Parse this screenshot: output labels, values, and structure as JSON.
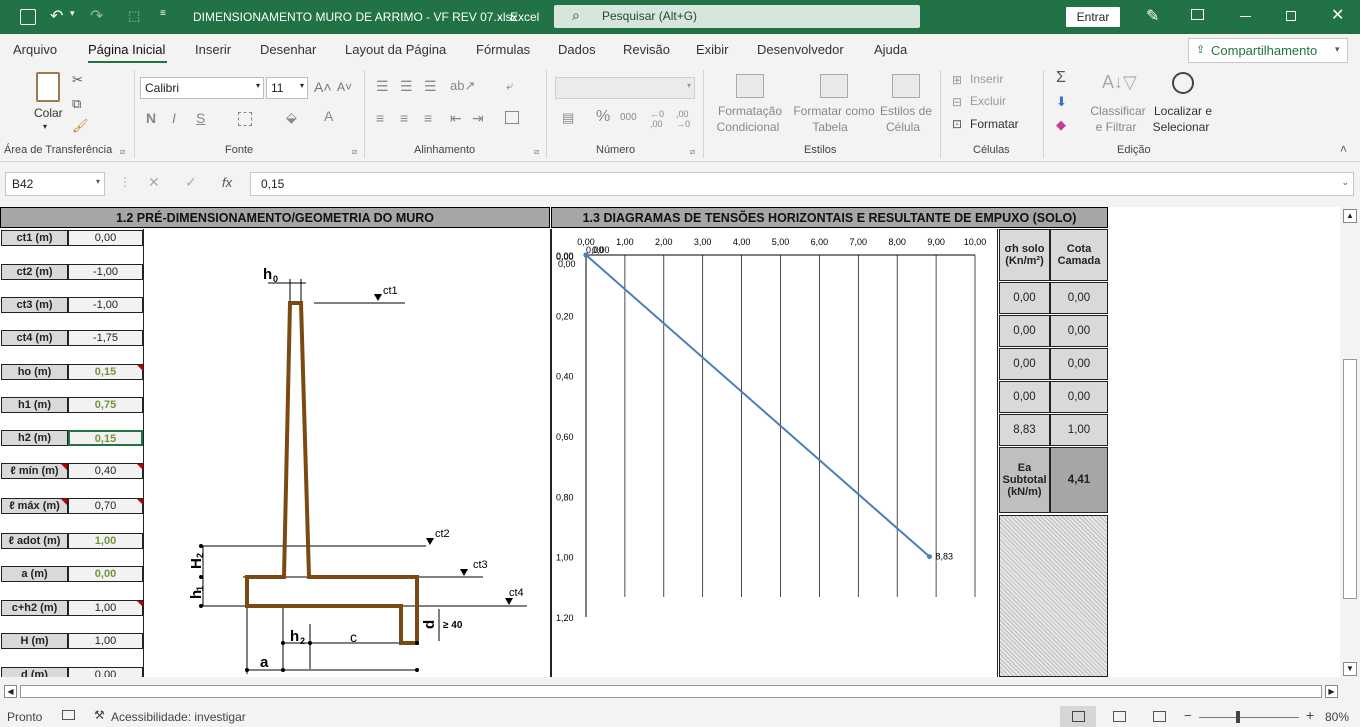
{
  "titlebar": {
    "filename": "DIMENSIONAMENTO MURO DE ARRIMO - VF REV 07.xlsx",
    "app": "Excel",
    "search": "Pesquisar (Alt+G)",
    "signin": "Entrar"
  },
  "menu": {
    "tabs": [
      "Arquivo",
      "Página Inicial",
      "Inserir",
      "Desenhar",
      "Layout da Página",
      "Fórmulas",
      "Dados",
      "Revisão",
      "Exibir",
      "Desenvolvedor",
      "Ajuda"
    ],
    "active": "Página Inicial",
    "share": "Compartilhamento"
  },
  "ribbon": {
    "paste": "Colar",
    "clipboard": "Área de Transferência",
    "font_name": "Calibri",
    "font_size": "11",
    "bold": "N",
    "italic": "I",
    "underline": "S",
    "font_group": "Fonte",
    "align_group": "Alinhamento",
    "number_group": "Número",
    "cond_format": [
      "Formatação",
      "Condicional"
    ],
    "format_table": [
      "Formatar como",
      "Tabela"
    ],
    "cell_styles": [
      "Estilos de",
      "Célula"
    ],
    "styles_group": "Estilos",
    "insert": "Inserir",
    "delete": "Excluir",
    "format": "Formatar",
    "cells_group": "Células",
    "sort": [
      "Classificar",
      "e Filtrar"
    ],
    "find": [
      "Localizar e",
      "Selecionar"
    ],
    "edit_group": "Edição"
  },
  "formula_bar": {
    "cell": "B42",
    "fx": "fx",
    "value": "0,15"
  },
  "sheet": {
    "header_left": "1.2 PRÉ-DIMENSIONAMENTO/GEOMETRIA DO MURO",
    "header_right": "1.3 DIAGRAMAS DE TENSÕES HORIZONTAIS E RESULTANTE DE EMPUXO (SOLO)",
    "params": [
      {
        "label": "ct1 (m)",
        "value": "0,00",
        "green": false
      },
      {
        "label": "ct2 (m)",
        "value": "-1,00",
        "green": false
      },
      {
        "label": "ct3 (m)",
        "value": "-1,00",
        "green": false
      },
      {
        "label": "ct4 (m)",
        "value": "-1,75",
        "green": false
      },
      {
        "label": "ho (m)",
        "value": "0,15",
        "green": true
      },
      {
        "label": "h1 (m)",
        "value": "0,75",
        "green": true
      },
      {
        "label": "h2 (m)",
        "value": "0,15",
        "green": true
      },
      {
        "label": "ℓ mín (m)",
        "value": "0,40",
        "green": false
      },
      {
        "label": "ℓ máx (m)",
        "value": "0,70",
        "green": false
      },
      {
        "label": "ℓ adot (m)",
        "value": "1,00",
        "green": true
      },
      {
        "label": "a (m)",
        "value": "0,00",
        "green": true
      },
      {
        "label": "c+h2 (m)",
        "value": "1,00",
        "green": false
      },
      {
        "label": "H (m)",
        "value": "1,00",
        "green": false
      },
      {
        "label": "d (m)",
        "value": "0,00",
        "green": false
      }
    ],
    "drawing_labels": {
      "h0": "h",
      "h0sub": "0",
      "ct1": "ct1",
      "ct2": "ct2",
      "ct3": "ct3",
      "ct4": "ct4",
      "H2": "H",
      "H2sub": "2",
      "h1": "h",
      "h1sub": "1",
      "h2": "h",
      "h2sub": "2",
      "c": "c",
      "a": "a",
      "d": "d",
      "geq40": "≥ 40"
    },
    "table": {
      "head1": "σh solo (Kn/m²)",
      "head2": "Cota Camada",
      "rows": [
        [
          "0,00",
          "0,00"
        ],
        [
          "0,00",
          "0,00"
        ],
        [
          "0,00",
          "0,00"
        ],
        [
          "0,00",
          "0,00"
        ],
        [
          "8,83",
          "1,00"
        ]
      ],
      "ea_label": "Ea Subtotal (kN/m)",
      "ea_value": "4,41"
    }
  },
  "chart_data": {
    "type": "line",
    "title": "",
    "xlabel": "σh solo (Kn/m²)",
    "ylabel": "",
    "x_ticks": [
      "0,00",
      "1,00",
      "2,00",
      "3,00",
      "4,00",
      "5,00",
      "6,00",
      "7,00",
      "8,00",
      "9,00",
      "10,00"
    ],
    "y_ticks": [
      "0,00",
      "0,20",
      "0,40",
      "0,60",
      "0,80",
      "1,00",
      "1,20"
    ],
    "xlim": [
      0,
      10
    ],
    "ylim": [
      0,
      1.2
    ],
    "y_inverted": true,
    "grid": "vertical",
    "series": [
      {
        "name": "",
        "x": [
          0,
          0,
          0,
          0,
          8.83
        ],
        "y": [
          0,
          0,
          0,
          0,
          1.0
        ],
        "labels": [
          "0,00",
          "0,00",
          "0,00",
          "0,00",
          "8,83"
        ]
      }
    ],
    "color": "#4a7ebb"
  },
  "status": {
    "ready": "Pronto",
    "access": "Acessibilidade: investigar",
    "zoom": "80%"
  }
}
